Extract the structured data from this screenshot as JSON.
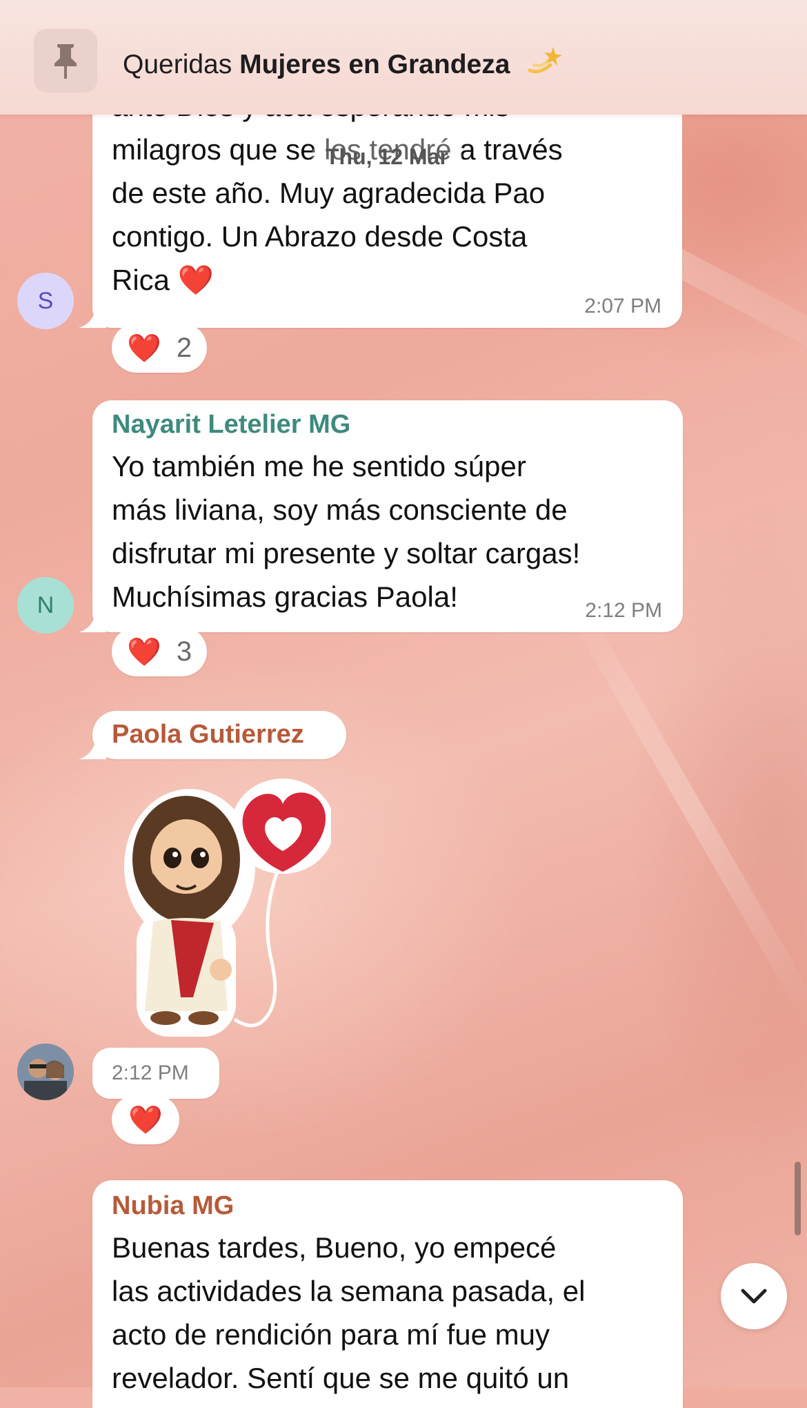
{
  "header": {
    "title_prefix": "Queridas",
    "title_bold": "Mujeres en Grandeza",
    "pin_icon": "pin-icon",
    "emoji": "dizzy-sparkle-emoji"
  },
  "date_separator": "Thu, 12 Mar",
  "messages": [
    {
      "avatar_letter": "S",
      "lines": [
        "ante Dios y aca esperando mis",
        "milagros que se los tendré a través",
        "de este año. Muy agradecida Pao",
        "contigo. Un Abrazo desde Costa",
        "Rica ❤️"
      ],
      "time": "2:07 PM",
      "reaction": {
        "emoji": "❤️",
        "count": "2"
      }
    },
    {
      "sender": "Nayarit Letelier MG",
      "sender_color": "#3e8a7e",
      "avatar_letter": "N",
      "lines": [
        "Yo también me he sentido súper",
        "más liviana, soy más consciente de",
        "disfrutar mi presente y soltar cargas!",
        "Muchísimas gracias Paola!"
      ],
      "time": "2:12 PM",
      "reaction": {
        "emoji": "❤️",
        "count": "3"
      }
    },
    {
      "sender": "Paola Gutierrez",
      "sender_color": "#b65a3a",
      "sticker": "jesus-with-heart-balloon-sticker",
      "time": "2:12 PM",
      "reaction": {
        "emoji": "❤️"
      }
    },
    {
      "sender": "Nubia MG",
      "sender_color": "#b65a3a",
      "lines": [
        "Buenas tardes, Bueno, yo empecé",
        "las actividades la semana pasada, el",
        "acto de rendición para mí fue muy",
        "revelador. Sentí que se me quitó un"
      ]
    }
  ],
  "scroll_button_icon": "chevron-down-icon"
}
